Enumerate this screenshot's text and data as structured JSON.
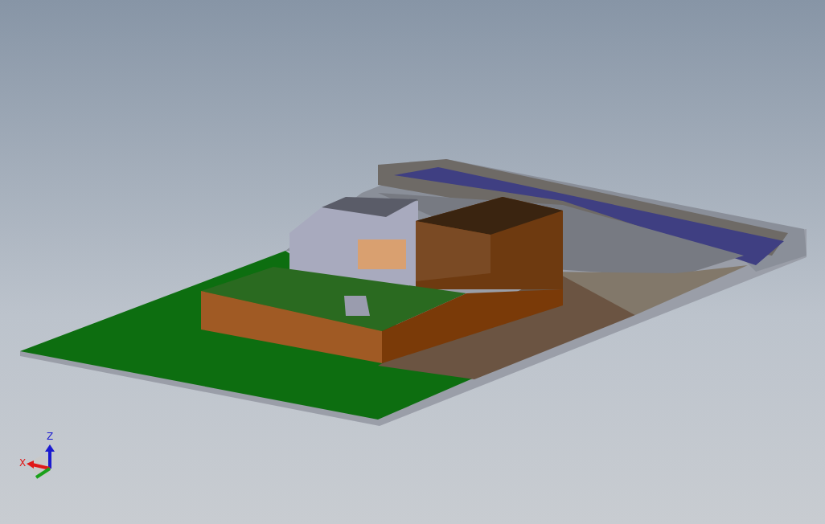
{
  "viewport": {
    "triad": {
      "axes": [
        {
          "label": "Z",
          "color": "#1a1ad0"
        },
        {
          "label": "X",
          "color": "#e01818"
        }
      ]
    }
  }
}
